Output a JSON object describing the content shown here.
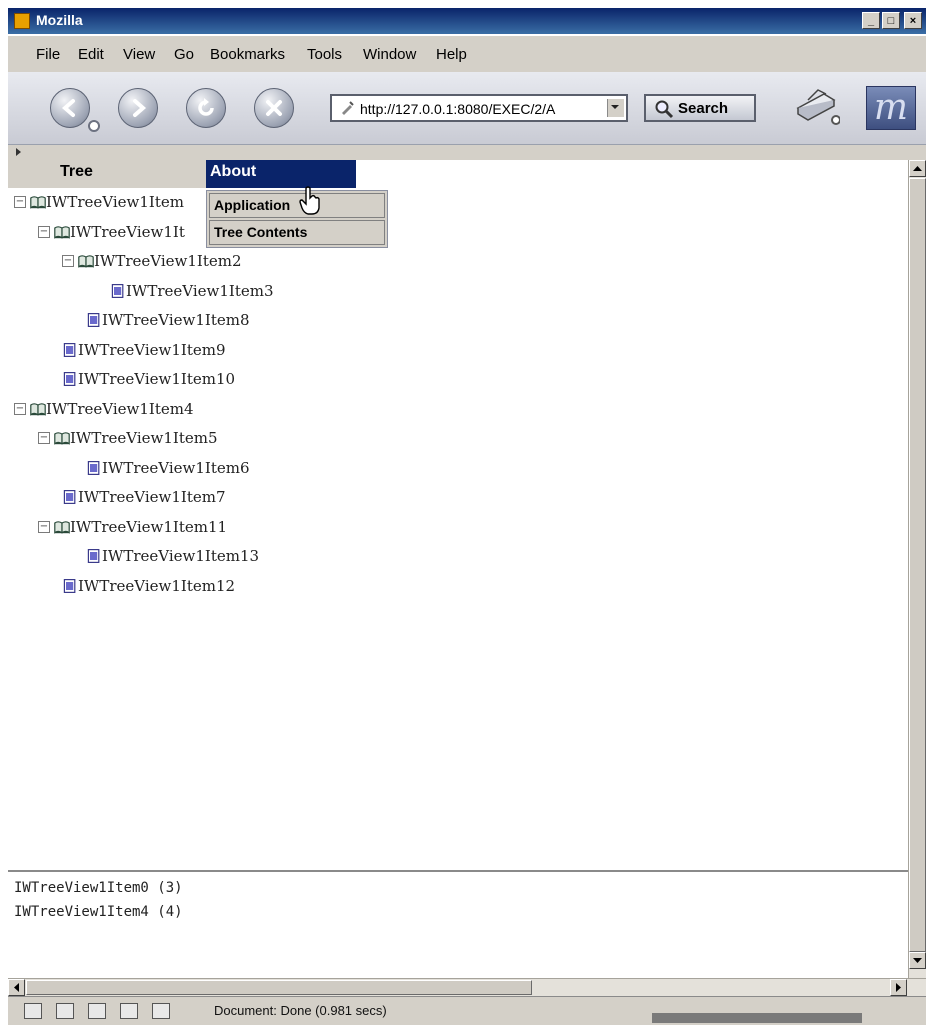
{
  "window": {
    "title": "Mozilla"
  },
  "menubar": [
    "File",
    "Edit",
    "View",
    "Go",
    "Bookmarks",
    "Tools",
    "Window",
    "Help"
  ],
  "navigation": {
    "url": "http://127.0.0.1:8080/EXEC/2/A",
    "search_label": "Search",
    "icons": [
      "back-icon",
      "forward-icon",
      "reload-icon",
      "stop-icon",
      "print-icon",
      "mozilla-logo-icon"
    ]
  },
  "page_menu": {
    "items": [
      "Tree",
      "About"
    ],
    "submenu": [
      "Application",
      "Tree Contents"
    ]
  },
  "tree": [
    {
      "label": "IWTreeView1Item",
      "type": "folder",
      "level": 0
    },
    {
      "label": "IWTreeView1It",
      "type": "folder",
      "level": 1
    },
    {
      "label": "IWTreeView1Item2",
      "type": "folder",
      "level": 2
    },
    {
      "label": "IWTreeView1Item3",
      "type": "document",
      "level": 3
    },
    {
      "label": "IWTreeView1Item8",
      "type": "document",
      "level": 2
    },
    {
      "label": "IWTreeView1Item9",
      "type": "document",
      "level": 1
    },
    {
      "label": "IWTreeView1Item10",
      "type": "document",
      "level": 1
    },
    {
      "label": "IWTreeView1Item4",
      "type": "folder",
      "level": 0
    },
    {
      "label": "IWTreeView1Item5",
      "type": "folder",
      "level": 1
    },
    {
      "label": "IWTreeView1Item6",
      "type": "document",
      "level": 2
    },
    {
      "label": "IWTreeView1Item7",
      "type": "document",
      "level": 1
    },
    {
      "label": "IWTreeView1Item11",
      "type": "folder",
      "level": 1
    },
    {
      "label": "IWTreeView1Item13",
      "type": "document",
      "level": 2
    },
    {
      "label": "IWTreeView1Item12",
      "type": "document",
      "level": 1
    }
  ],
  "log": [
    "IWTreeView1Item0 (3)",
    "IWTreeView1Item4 (4)"
  ],
  "status": {
    "text": "Document: Done (0.981 secs)"
  },
  "colors": {
    "titlebar": "#0a246a",
    "menu_highlight": "#0a246a",
    "chrome": "#d4d0c8"
  }
}
